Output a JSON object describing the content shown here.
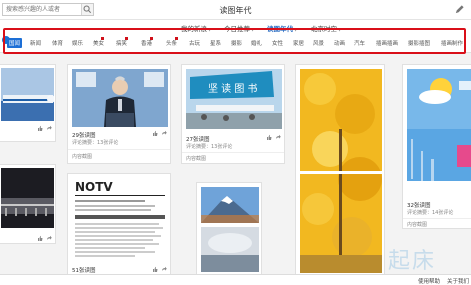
{
  "header": {
    "search_placeholder": "搜索感兴趣的人或者",
    "app_title": "读图年代"
  },
  "subnav": {
    "tabs": [
      {
        "label": "我的新浪"
      },
      {
        "label": "今日推荐"
      },
      {
        "label": "读图年代"
      },
      {
        "label": "北京时空"
      }
    ],
    "active_index": 2
  },
  "categories": {
    "items": [
      "国闻",
      "新闻",
      "体育",
      "娱乐",
      "美女",
      "搞笑",
      "香港",
      "头条",
      "古玩",
      "星系",
      "摄影",
      "婚礼",
      "女性",
      "家居",
      "风景",
      "动画",
      "汽车",
      "插画插画",
      "摄影插图",
      "插画制作"
    ]
  },
  "cards": [
    {
      "title": "",
      "info": "",
      "from": ""
    },
    {
      "title": "29张读图",
      "info": "评论摘要：13张评论",
      "from": "内容截图"
    },
    {
      "title": "27张读图",
      "info": "评论摘要：13张评论",
      "from": "内容截图"
    },
    {
      "title": "",
      "info": "",
      "from": ""
    },
    {
      "title": "32张读图",
      "info": "评论摘要：14张评论",
      "from": "内容截图"
    },
    {
      "title": "",
      "info": "",
      "from": ""
    },
    {
      "title": "51张读图",
      "info": "",
      "from": ""
    },
    {
      "title": "",
      "info": "",
      "from": ""
    }
  ],
  "card_images": {
    "news_logo": "NOTV",
    "blue_banner": "坚 读 图 书"
  },
  "footer": {
    "help": "使用帮助",
    "about": "关于我们"
  },
  "watermark": "起床",
  "colors": {
    "accent": "#2a6cc2",
    "category_active": "#1d6fd6",
    "highlight_box": "#d90f19"
  }
}
